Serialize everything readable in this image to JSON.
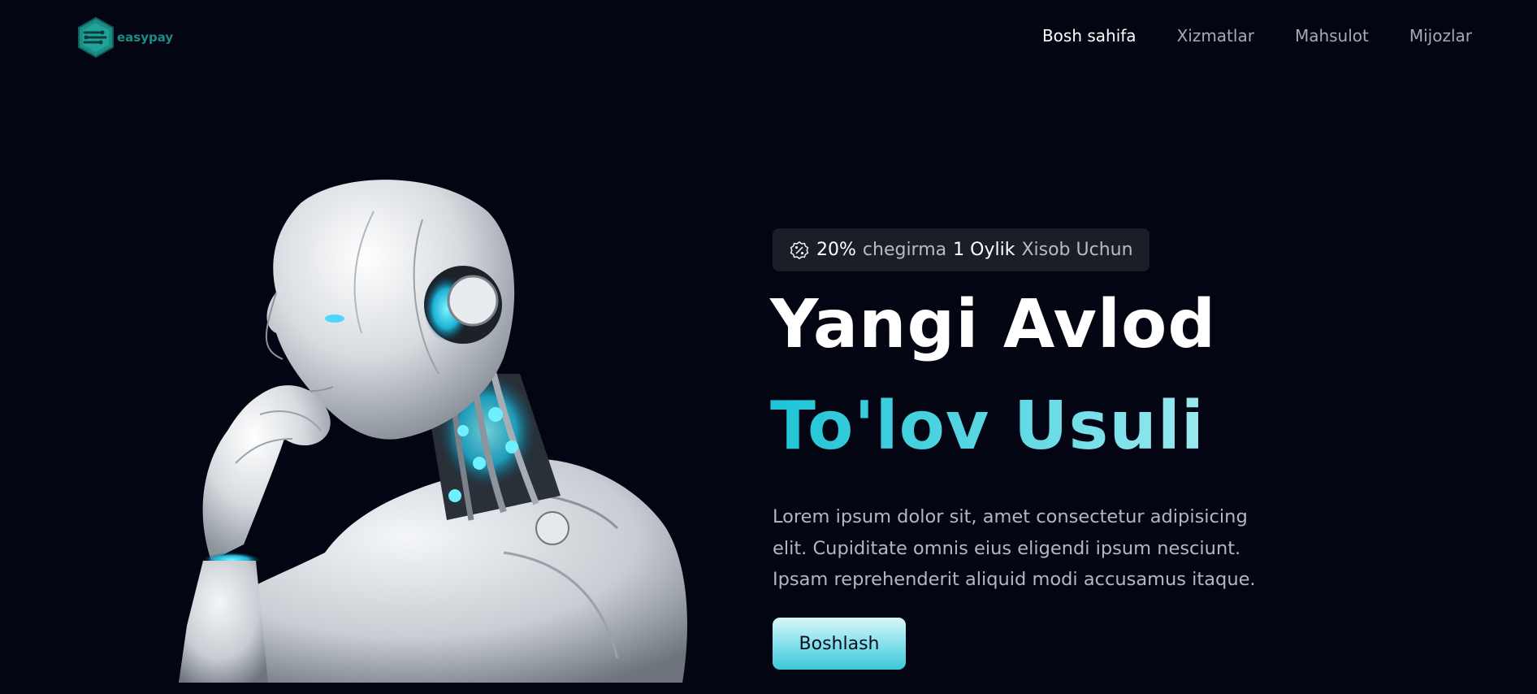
{
  "header": {
    "logo_text": "easypay",
    "nav": [
      {
        "label": "Bosh sahifa",
        "active": true
      },
      {
        "label": "Xizmatlar",
        "active": false
      },
      {
        "label": "Mahsulot",
        "active": false
      },
      {
        "label": "Mijozlar",
        "active": false
      }
    ]
  },
  "hero": {
    "badge": {
      "icon": "percent-badge-icon",
      "percent": "20%",
      "text_1": "chegirma",
      "period": "1 Oylik",
      "text_2": "Xisob Uchun"
    },
    "title_line_1": "Yangi Avlod",
    "title_line_2": "To'lov Usuli",
    "description": "Lorem ipsum dolor sit, amet consectetur adipisicing elit. Cupiditate omnis eius eligendi ipsum nesciunt. Ipsam reprehenderit aliquid modi accusamus itaque.",
    "cta_label": "Boshlash",
    "illustration": "robot-thinking-icon"
  },
  "colors": {
    "background": "#030612",
    "accent": "#3cc8d9",
    "logo": "#1b8c84",
    "badge_bg": "#1b1d27"
  }
}
